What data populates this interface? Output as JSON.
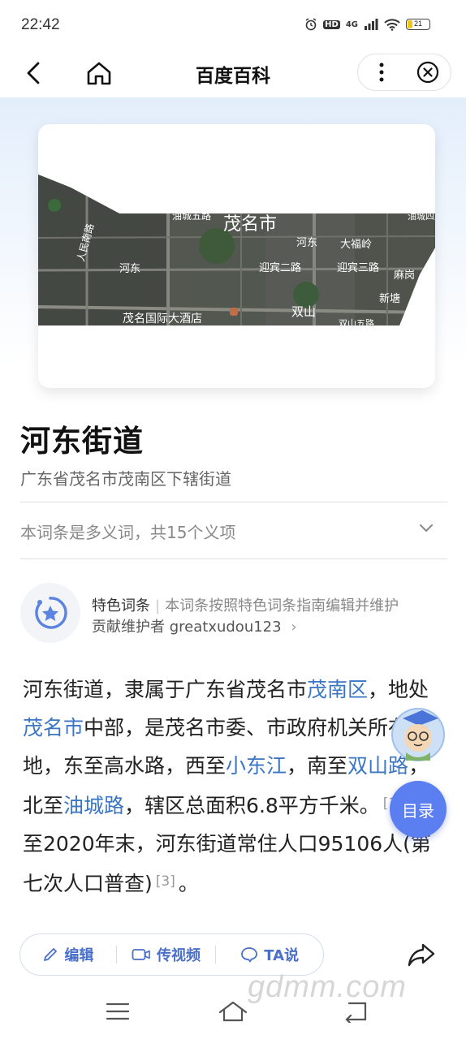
{
  "status": {
    "time": "22:42",
    "network": "4G",
    "hd": "HD",
    "battery": "21"
  },
  "nav": {
    "title": "百度百科"
  },
  "entry": {
    "title": "河东街道",
    "subtitle": "广东省茂名市茂南区下辖街道",
    "polysemy": "本词条是多义词，共15个义项"
  },
  "map_labels": [
    "油城五路",
    "茂名市",
    "河东",
    "大福岭",
    "迎宾二路",
    "迎宾三路",
    "河东",
    "麻岗",
    "新塘",
    "茂名国际大酒店",
    "双山",
    "双山五路",
    "油城四路",
    "人民南路"
  ],
  "feature": {
    "tag": "特色词条",
    "separator": "|",
    "description": "本词条按照特色词条指南编辑并维护",
    "maintainer": "贡献维护者 greatxudou123",
    "arrow": "›"
  },
  "body": {
    "p1": "河东街道，隶属于广东省茂名市",
    "link1": "茂南区",
    "p2": "，地处",
    "link2": "茂名市",
    "p3": "中部，是茂名市委、市政府机关所在地，东至高水路，西至",
    "link3": "小东江",
    "p4": "，南至",
    "link4": "双山路",
    "p5": "，北至",
    "link5": "油城路",
    "p6": "，辖区总面积6.8平方千米。",
    "cite1": "[1]",
    "p7": "截至2020年末，河东街道常住人口95106人(第七次人口普查)",
    "cite2": "[3]",
    "p8": "。"
  },
  "toc": {
    "label": "目录"
  },
  "actions": {
    "edit": "编辑",
    "video": "传视频",
    "ta": "TA说"
  },
  "watermark": "gdmm.com",
  "colors": {
    "link": "#3a76c4",
    "accent": "#5b7ef0",
    "action": "#4a6fc8"
  }
}
